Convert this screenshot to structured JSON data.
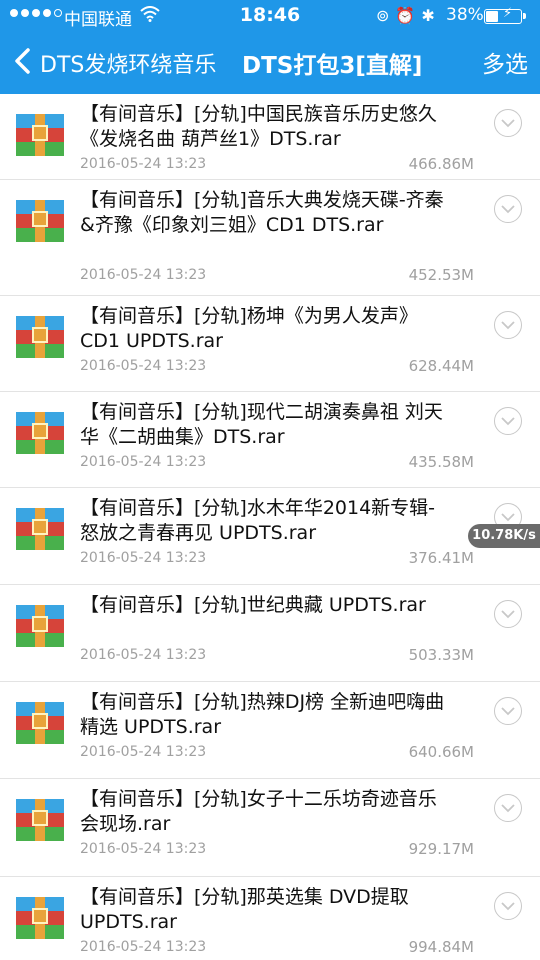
{
  "status_bar": {
    "carrier": "中国联通",
    "time": "18:46",
    "battery_percent": "38%",
    "signal_bars_filled": 4,
    "battery_level": 0.38
  },
  "nav": {
    "back_label": "DTS发烧环绕音乐",
    "title": "DTS打包3[直解]",
    "multi_select": "多选"
  },
  "speed_badge": "10.78K/s",
  "files": [
    {
      "name": "【有间音乐】[分轨]中国民族音乐历史悠久《发烧名曲 葫芦丝1》DTS.rar",
      "date": "2016-05-24 13:23",
      "size": "466.86M"
    },
    {
      "name": "【有间音乐】[分轨]音乐大典发烧天碟-齐秦&齐豫《印象刘三姐》CD1 DTS.rar",
      "date": "2016-05-24 13:23",
      "size": "452.53M"
    },
    {
      "name": "【有间音乐】[分轨]杨坤《为男人发声》CD1 UPDTS.rar",
      "date": "2016-05-24 13:23",
      "size": "628.44M"
    },
    {
      "name": "【有间音乐】[分轨]现代二胡演奏鼻祖 刘天华《二胡曲集》DTS.rar",
      "date": "2016-05-24 13:23",
      "size": "435.58M"
    },
    {
      "name": "【有间音乐】[分轨]水木年华2014新专辑-怒放之青春再见 UPDTS.rar",
      "date": "2016-05-24 13:23",
      "size": "376.41M"
    },
    {
      "name": "【有间音乐】[分轨]世纪典藏 UPDTS.rar",
      "date": "2016-05-24 13:23",
      "size": "503.33M"
    },
    {
      "name": "【有间音乐】[分轨]热辣DJ榜 全新迪吧嗨曲精选 UPDTS.rar",
      "date": "2016-05-24 13:23",
      "size": "640.66M"
    },
    {
      "name": "【有间音乐】[分轨]女子十二乐坊奇迹音乐会现场.rar",
      "date": "2016-05-24 13:23",
      "size": "929.17M"
    },
    {
      "name": "【有间音乐】[分轨]那英选集 DVD提取 UPDTS.rar",
      "date": "2016-05-24 13:23",
      "size": "994.84M"
    }
  ],
  "colors": {
    "header_bg": "#1f97e8",
    "meta_text": "#a0a0a0"
  },
  "icons": {
    "file_icon": "rar-archive-icon",
    "row_action": "chevron-down-circle-icon",
    "back": "chevron-left-icon"
  }
}
